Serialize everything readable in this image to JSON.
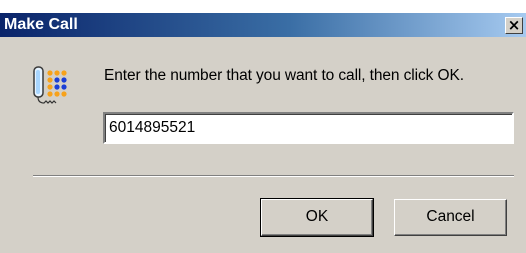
{
  "window": {
    "title": "Make Call",
    "close_glyph": "×"
  },
  "dialog": {
    "icon": "phone-keypad-icon",
    "prompt": "Enter the number that you want to call, then click OK.",
    "number_value": "6014895521"
  },
  "buttons": {
    "ok_label": "OK",
    "cancel_label": "Cancel"
  },
  "colors": {
    "titlebar_start": "#0a246a",
    "titlebar_end": "#a6caf0",
    "dialog_face": "#d4d0c8",
    "keypad_orange": "#f7a21b",
    "keypad_blue": "#1c3fd6"
  }
}
